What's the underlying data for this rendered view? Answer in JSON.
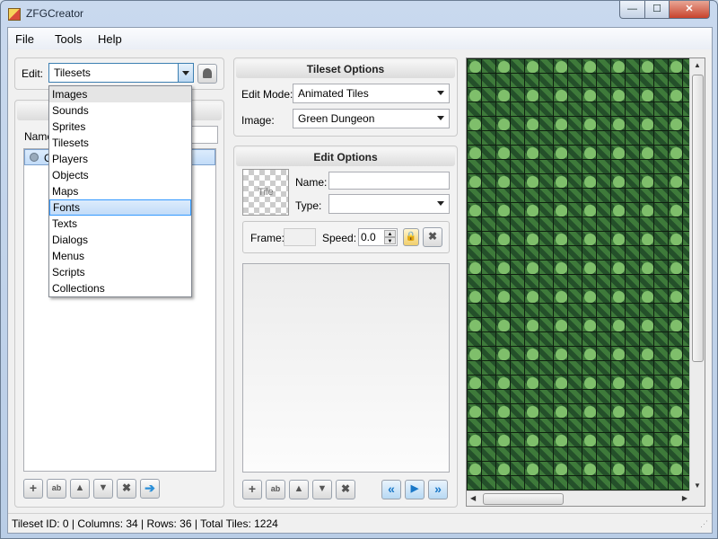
{
  "window": {
    "title": "ZFGCreator",
    "minimize_glyph": "—",
    "maximize_glyph": "☐",
    "close_glyph": "✕"
  },
  "menu": [
    "File",
    "Tools",
    "Help"
  ],
  "edit": {
    "label": "Edit:",
    "selected": "Tilesets",
    "options": [
      "Images",
      "Sounds",
      "Sprites",
      "Tilesets",
      "Players",
      "Objects",
      "Maps",
      "Fonts",
      "Texts",
      "Dialogs",
      "Menus",
      "Scripts",
      "Collections"
    ],
    "highlighted": "Fonts",
    "stamp_icon": "stamp-icon"
  },
  "left_panel": {
    "name_label": "Name",
    "tree_item_text": "G"
  },
  "tileset_options": {
    "header": "Tileset Options",
    "edit_mode_label": "Edit Mode:",
    "edit_mode_value": "Animated Tiles",
    "image_label": "Image:",
    "image_value": "Green Dungeon"
  },
  "edit_options": {
    "header": "Edit Options",
    "tile_preview_text": "Tile",
    "name_label": "Name:",
    "name_value": "",
    "type_label": "Type:",
    "type_value": "",
    "frame_label": "Frame:",
    "frame_value": "",
    "speed_label": "Speed:",
    "speed_value": "0.0"
  },
  "toolbar_icons": {
    "add": "+",
    "rename": "ab",
    "up": "▲",
    "down": "▼",
    "delete": "✖",
    "forward": "➔",
    "lock": "🔒",
    "first": "«",
    "play": "▶",
    "last": "»"
  },
  "status": "Tileset ID: 0 | Columns: 34 | Rows: 36 | Total Tiles: 1224"
}
